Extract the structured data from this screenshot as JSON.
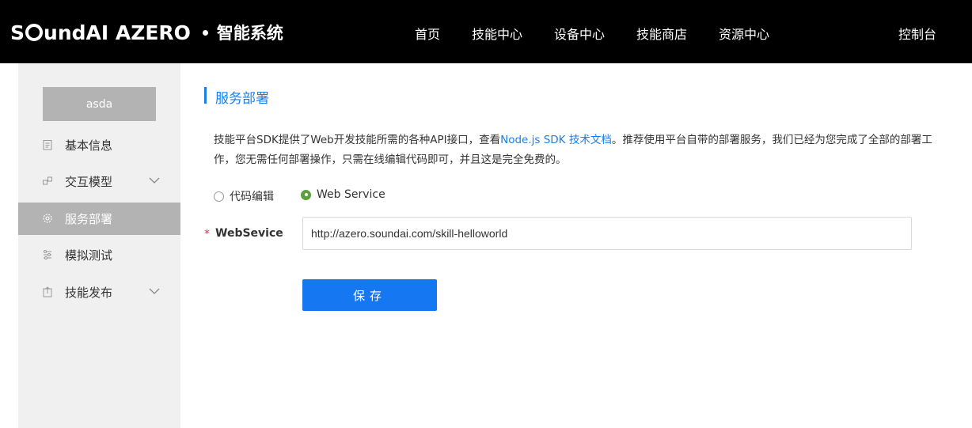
{
  "header": {
    "brand_name": "SoundAI AZERO",
    "brand_sub": "智能系统",
    "nav": [
      "首页",
      "技能中心",
      "设备中心",
      "技能商店",
      "资源中心"
    ],
    "console": "控制台"
  },
  "sidebar": {
    "user": "asda",
    "items": [
      {
        "label": "基本信息",
        "icon": "document-icon",
        "expandable": false,
        "active": false
      },
      {
        "label": "交互模型",
        "icon": "model-icon",
        "expandable": true,
        "active": false
      },
      {
        "label": "服务部署",
        "icon": "gear-icon",
        "expandable": false,
        "active": true
      },
      {
        "label": "模拟测试",
        "icon": "sliders-icon",
        "expandable": false,
        "active": false
      },
      {
        "label": "技能发布",
        "icon": "upload-icon",
        "expandable": true,
        "active": false
      }
    ]
  },
  "main": {
    "title": "服务部署",
    "desc_part1": "技能平台SDK提供了Web开发技能所需的各种API接口，查看",
    "desc_link": "Node.js SDK 技术文档",
    "desc_part2": "。推荐使用平台自带的部署服务，我们已经为您完成了全部的部署工作，您无需任何部署操作，只需在线编辑代码即可，并且这是完全免费的。",
    "radio_options": [
      {
        "label": "代码编辑",
        "selected": false
      },
      {
        "label": "Web Service",
        "selected": true
      }
    ],
    "field_required_mark": "*",
    "field_label": "WebSevice",
    "field_value": "http://azero.soundai.com/skill-helloworld",
    "save_label": "保存"
  },
  "colors": {
    "header_bg": "#000000",
    "accent": "#1a7fe8",
    "button": "#1677f2",
    "radio_selected": "#5aa03c",
    "sidebar_bg": "#f0f0f0",
    "sidebar_active": "#b3b3b3"
  }
}
